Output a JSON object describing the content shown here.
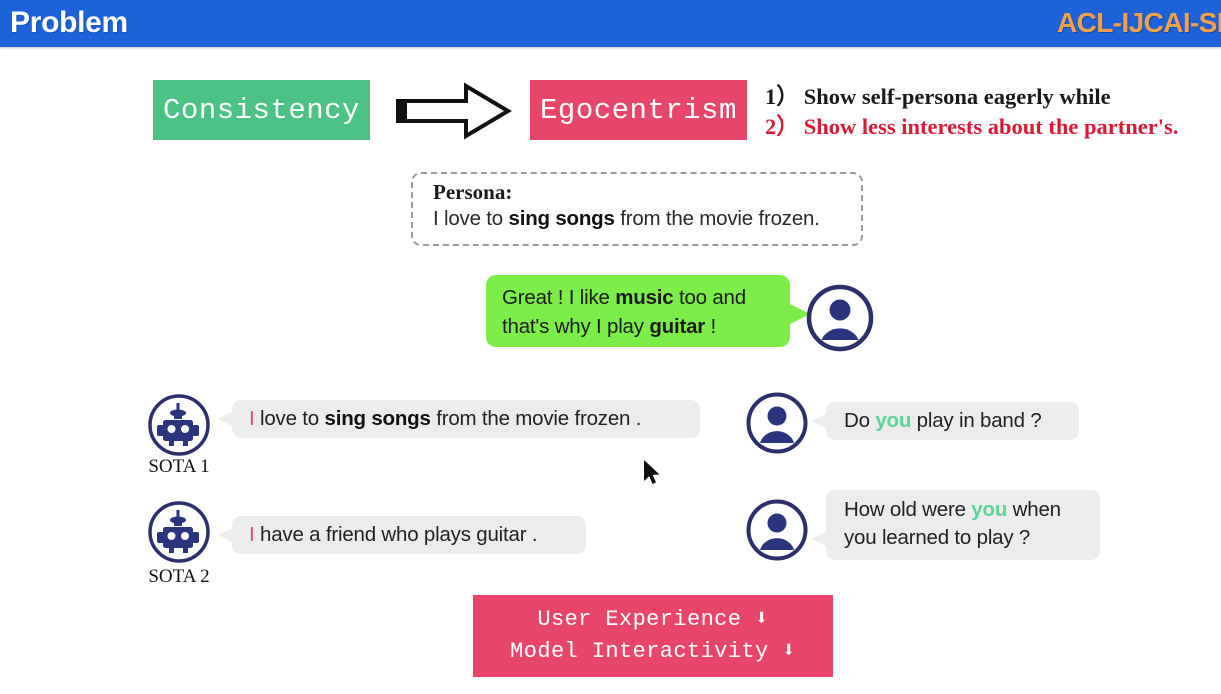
{
  "header": {
    "title": "Problem",
    "conference": "ACL-IJCAI-SI",
    "bar_color": "#1d62d8",
    "title_color": "#ffffff",
    "conference_color": "#f0a04a"
  },
  "flow": {
    "from_label": "Consistency",
    "from_color": "#4bc183",
    "to_label": "Egocentrism",
    "to_color": "#e8456b",
    "arrow_icon": "right-arrow-outline-icon"
  },
  "problem_list": [
    {
      "num": "1）",
      "text": "Show self-persona eagerly while",
      "color": "#1a1a1a"
    },
    {
      "num": "2）",
      "text": "Show less interests about the partner's.",
      "color": "#d81b33"
    }
  ],
  "persona": {
    "heading": "Persona:",
    "text_before": "I love to ",
    "text_bold": "sing songs",
    "text_after": " from the movie frozen."
  },
  "user_bubble": {
    "line1_before": "Great ! I like ",
    "line1_bold": "music",
    "line1_after": " too and",
    "line2_before": "that's why I play ",
    "line2_bold": "guitar",
    "line2_after": " !",
    "bubble_color": "#7dee49",
    "avatar_icon": "person-avatar-icon"
  },
  "dialogue": {
    "sota1": {
      "avatar_icon": "robot-avatar-icon",
      "label": "SOTA 1",
      "pronoun": "I",
      "pronoun_color": "#e8456b",
      "text_before": " love to ",
      "text_bold": "sing songs",
      "text_after": " from the movie frozen ."
    },
    "sota2": {
      "avatar_icon": "robot-avatar-icon",
      "label": "SOTA 2",
      "pronoun": "I",
      "pronoun_color": "#e8456b",
      "text_before": " have a friend who plays guitar .",
      "text_bold": "",
      "text_after": ""
    },
    "user1": {
      "avatar_icon": "person-avatar-icon",
      "text_before": "Do ",
      "highlight": "you",
      "highlight_color": "#5fd39a",
      "text_after": " play in band ?"
    },
    "user2": {
      "avatar_icon": "person-avatar-icon",
      "line1_before": "How old were ",
      "line1_highlight": "you",
      "line1_after": " when",
      "line2": "you learned to play ?",
      "highlight_color": "#5fd39a"
    }
  },
  "conclusion": {
    "line1": "User Experience ⬇",
    "line2": "Model Interactivity ⬇",
    "box_color": "#e8456b",
    "text_color": "#ffffff"
  },
  "cursor": {
    "icon": "mouse-pointer-icon"
  }
}
